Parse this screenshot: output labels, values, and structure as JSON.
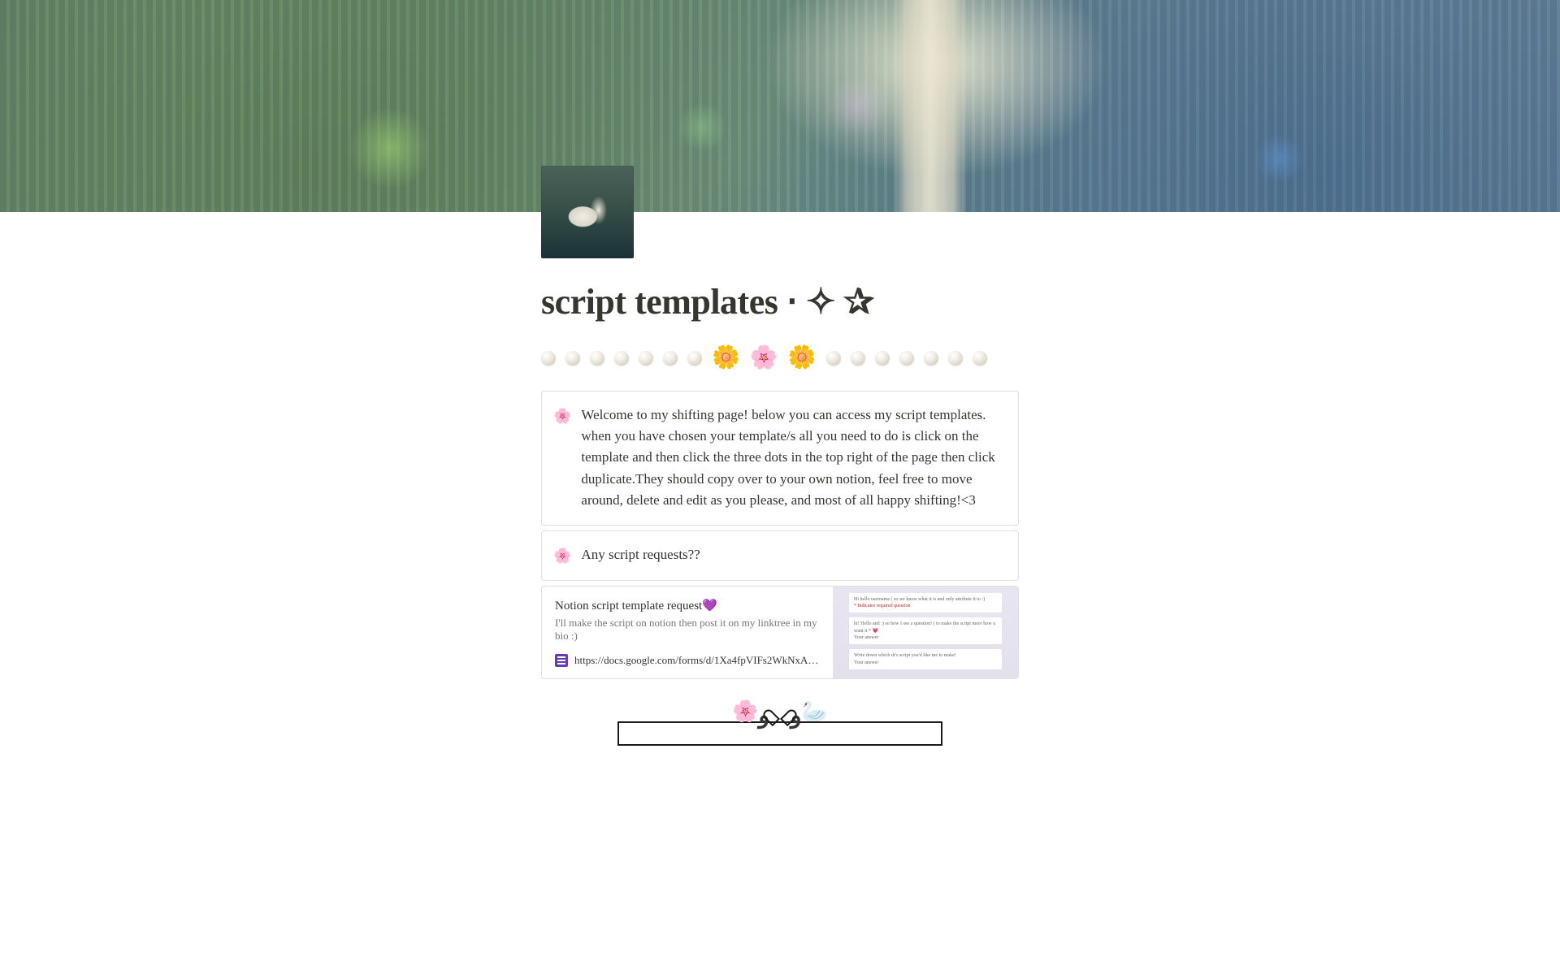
{
  "page": {
    "title": "script templates ⋅ ✧ ✰"
  },
  "divider": {
    "flowers": [
      "🌼",
      "🌸",
      "🌼"
    ]
  },
  "callouts": {
    "welcome": {
      "emoji": "🌸",
      "text": " Welcome to my shifting page! below you can access my script templates. when you have chosen your template/s all you need to do is click on the template and then click the three dots in the top right of the page then click duplicate.They should copy over to your own notion, feel free to move around, delete and edit as you please, and most of all happy shifting!<3"
    },
    "requests": {
      "emoji": "🌸",
      "text": "Any script requests??"
    }
  },
  "bookmark": {
    "title": "Notion script template request💜",
    "description": "I'll make the script on notion then post it on my linktree in my bio :)",
    "url": "https://docs.google.com/forms/d/1Xa4fpVIFs2WkNxA_H6iIbkLdMvEt_7-F…"
  },
  "form_preview": {
    "q1": "Hi hello username ( so we know what it is and only attribute it to :)",
    "q1_note": "* Indicates required question",
    "q2": "hi! Hello and :) so how I see a question! ( to make the script more how u want it *",
    "q2_hint": "💗",
    "q2_note": "Your answer",
    "q3": "Write down which dr's script you'd like me to make!",
    "q3_note": "Your answer"
  },
  "widget": {
    "emojis_left": "🌸",
    "emojis_right": "🦢"
  }
}
